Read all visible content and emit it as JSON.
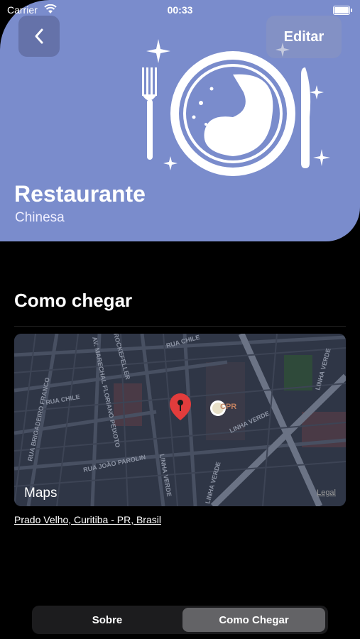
{
  "status": {
    "carrier": "Carrier",
    "time": "00:33"
  },
  "header": {
    "edit_label": "Editar"
  },
  "restaurant": {
    "name": "Restaurante",
    "cuisine": "Chinesa"
  },
  "directions": {
    "title": "Como chegar",
    "address": "Prado Velho, Curitiba - PR, Brasil",
    "map": {
      "brand": "Maps",
      "legal": "Legal",
      "poi": "CPR",
      "streets": [
        "RUA CHILE",
        "RUA CHILE",
        "RUA JOÃO PAROLIN",
        "RUA BRIGADEIRO FRANCO",
        "LINHA VERDE",
        "LINHA VERDE",
        "LINHA VERDE",
        "AV. MARECHAL FLORIANO PEIXOTO",
        "ROCKEFELLER",
        "LINHA VERDE"
      ]
    }
  },
  "tabs": [
    {
      "label": "Sobre",
      "selected": false
    },
    {
      "label": "Como Chegar",
      "selected": true
    }
  ],
  "colors": {
    "hero": "#7a8ccc",
    "pin": "#e23c3c",
    "selected_tab": "#636366"
  }
}
